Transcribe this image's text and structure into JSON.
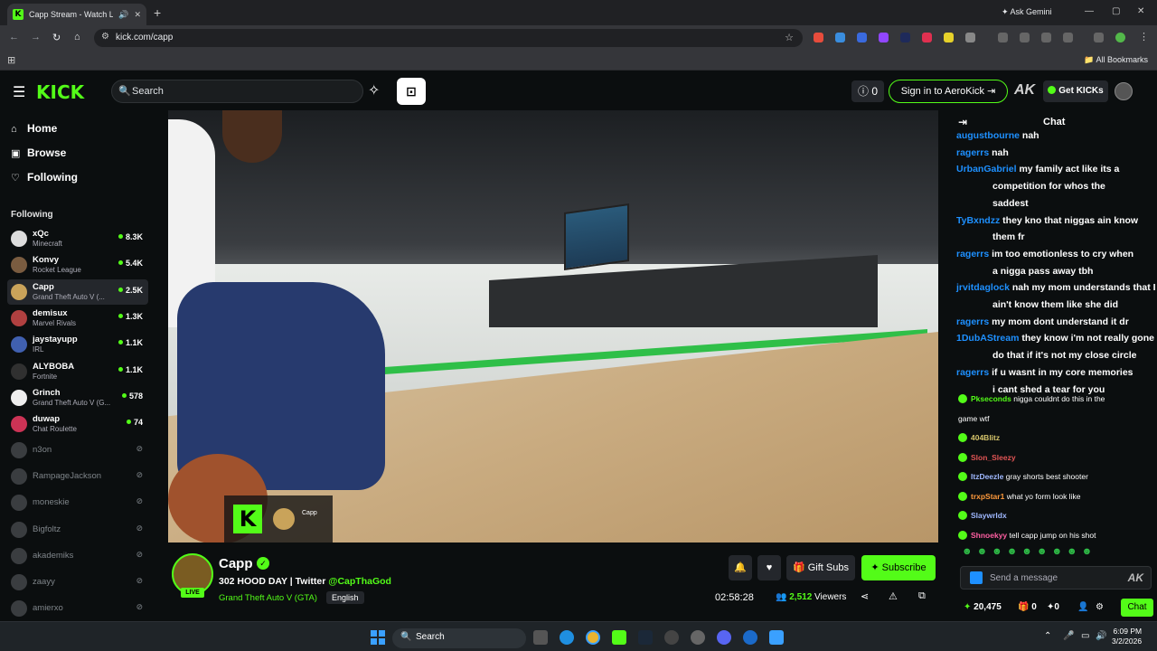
{
  "browser": {
    "tab_title": "Capp Stream - Watch Live",
    "address": "kick.com/capp",
    "ask_gemini": "Ask Gemini",
    "all_bookmarks": "All Bookmarks"
  },
  "header": {
    "logo": "KICK",
    "search_placeholder": "Search",
    "notif_count": "0",
    "sign_in": "Sign in to AeroKick",
    "ak_logo": "AK",
    "get_kicks": "Get KICKs"
  },
  "nav": {
    "home": "Home",
    "browse": "Browse",
    "following": "Following",
    "following_label": "Following"
  },
  "following_channels": [
    {
      "name": "xQc",
      "category": "Minecraft",
      "viewers": "8.3K",
      "color": "#ddd"
    },
    {
      "name": "Konvy",
      "category": "Rocket League",
      "viewers": "5.4K",
      "color": "#7a5c40"
    },
    {
      "name": "Capp",
      "category": "Grand Theft Auto V (...",
      "viewers": "2.5K",
      "color": "#c9a35a"
    },
    {
      "name": "demisux",
      "category": "Marvel Rivals",
      "viewers": "1.3K",
      "color": "#b04040"
    },
    {
      "name": "jaystayupp",
      "category": "IRL",
      "viewers": "1.1K",
      "color": "#4060b0"
    },
    {
      "name": "ALYBOBA",
      "category": "Fortnite",
      "viewers": "1.1K",
      "color": "#303030"
    },
    {
      "name": "Grinch",
      "category": "Grand Theft Auto V (G...",
      "viewers": "578",
      "color": "#eee"
    },
    {
      "name": "duwap",
      "category": "Chat Roulette",
      "viewers": "74",
      "color": "#cc3355"
    }
  ],
  "offline_channels": [
    "n3on",
    "RampageJackson",
    "moneskie",
    "Bigfoltz",
    "akademiks",
    "zaayy",
    "amierxo"
  ],
  "overlay": {
    "name": "Capp",
    "sub": "—"
  },
  "stream": {
    "channel": "Capp",
    "title_prefix": "302 HOOD DAY | Twitter ",
    "twitter": "@CapThaGod",
    "category": "Grand Theft Auto V (GTA)",
    "language": "English",
    "gift_subs": "Gift Subs",
    "subscribe": "Subscribe",
    "uptime": "02:58:28",
    "viewers": "2,512",
    "viewers_label": "Viewers",
    "live": "LIVE"
  },
  "chat": {
    "title": "Chat",
    "messages": [
      {
        "user": "augustbourne",
        "text": "nah"
      },
      {
        "user": "ragerrs",
        "text": "nah"
      },
      {
        "user": "UrbanGabriel",
        "text": "my family act like its a"
      },
      {
        "user": "",
        "text": "competition for whos the"
      },
      {
        "user": "",
        "text": "saddest"
      },
      {
        "user": "TyBxndzz",
        "text": "they kno that niggas ain know"
      },
      {
        "user": "",
        "text": "them fr"
      },
      {
        "user": "ragerrs",
        "text": "im too emotionless to cry when"
      },
      {
        "user": "",
        "text": "a nigga pass away tbh"
      },
      {
        "user": "jrvitdaglock",
        "text": "nah my mom understands that I"
      },
      {
        "user": "",
        "text": "ain't know them like she did"
      },
      {
        "user": "ragerrs",
        "text": "my mom dont understand it dr"
      },
      {
        "user": "1DubAStream",
        "text": "they know i'm not really gone"
      },
      {
        "user": "",
        "text": "do that if it's not my close circle"
      },
      {
        "user": "ragerrs",
        "text": "if u wasnt in my core memories"
      },
      {
        "user": "",
        "text": "i cant shed a tear for you"
      }
    ],
    "lower_messages": [
      {
        "user": "Pkseconds",
        "text": "nigga couldnt do this in the"
      },
      {
        "user": "",
        "text": "game wtf"
      },
      {
        "user": "404Blitz",
        "text": ""
      },
      {
        "user": "Slon_Sleezy",
        "text": ""
      },
      {
        "user": "ItzDeezle",
        "text": "gray shorts best shooter"
      },
      {
        "user": "trxpStar1",
        "text": "what yo form look like"
      },
      {
        "user": "Slaywrldx",
        "text": ""
      },
      {
        "user": "Shnoekyy",
        "text": "tell capp jump on his shot"
      }
    ],
    "input_placeholder": "Send a message",
    "points": "20,475",
    "count_a": "0",
    "count_b": "0",
    "chat_button": "Chat"
  },
  "taskbar": {
    "search": "Search",
    "time": "6:09 PM",
    "date": "3/2/2026"
  }
}
